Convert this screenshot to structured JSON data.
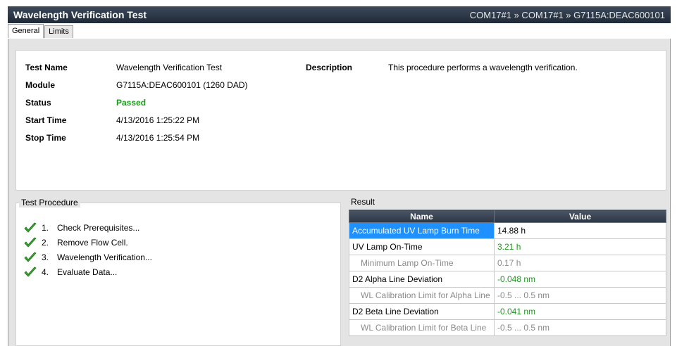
{
  "window": {
    "title": "Wavelength Verification Test",
    "breadcrumb": "COM17#1 » COM17#1 » G7115A:DEAC600101"
  },
  "tabs": [
    {
      "label": "General",
      "active": true
    },
    {
      "label": "Limits",
      "active": false
    }
  ],
  "info": {
    "test_name_label": "Test Name",
    "test_name": "Wavelength Verification Test",
    "module_label": "Module",
    "module": "G7115A:DEAC600101 (1260 DAD)",
    "status_label": "Status",
    "status": "Passed",
    "start_time_label": "Start Time",
    "start_time": "4/13/2016 1:25:22 PM",
    "stop_time_label": "Stop Time",
    "stop_time": "4/13/2016 1:25:54 PM",
    "description_label": "Description",
    "description": "This procedure performs a wavelength verification."
  },
  "procedure": {
    "title": "Test Procedure",
    "steps": [
      {
        "num": "1.",
        "label": "Check Prerequisites...",
        "icon": "check-icon"
      },
      {
        "num": "2.",
        "label": "Remove Flow Cell.",
        "icon": "check-icon"
      },
      {
        "num": "3.",
        "label": "Wavelength Verification...",
        "icon": "check-icon"
      },
      {
        "num": "4.",
        "label": "Evaluate Data...",
        "icon": "check-icon"
      }
    ]
  },
  "result": {
    "title": "Result",
    "columns": [
      "Name",
      "Value"
    ],
    "rows": [
      {
        "name": "Accumulated UV Lamp Burn Time",
        "value": "14.88 h"
      },
      {
        "name": "UV Lamp On-Time",
        "value": "3.21 h"
      },
      {
        "name": "Minimum Lamp On-Time",
        "value": "0.17 h"
      },
      {
        "name": "D2 Alpha Line Deviation",
        "value": "-0.048 nm"
      },
      {
        "name": "WL Calibration Limit for Alpha Line",
        "value": "-0.5 ... 0.5 nm"
      },
      {
        "name": "D2 Beta Line Deviation",
        "value": "-0.041 nm"
      },
      {
        "name": "WL Calibration Limit for Beta Line",
        "value": "-0.5 ... 0.5 nm"
      }
    ]
  },
  "colors": {
    "passed": "#1a9a1a",
    "selection": "#1e90ff",
    "header": "#2c3644"
  }
}
